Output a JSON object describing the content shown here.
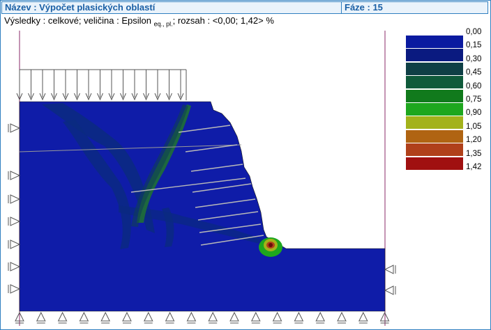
{
  "header": {
    "title": "Název : Výpočet plasických oblastí",
    "phase": "Fáze : 15"
  },
  "results": {
    "prefix": "Výsledky : celkové; veličina : Epsilon",
    "subscript": "eq., pl.",
    "suffix": "; rozsah : <0,00; 1,42> %"
  },
  "legend": {
    "labels": [
      "0,00",
      "0,15",
      "0,30",
      "0,45",
      "0,60",
      "0,75",
      "0,90",
      "1,05",
      "1,20",
      "1,35",
      "1,42"
    ],
    "colors": [
      "#0a1aa0",
      "#0a1a80",
      "#0f3f45",
      "#0f5a3a",
      "#117a1c",
      "#1ea71e",
      "#a3b21a",
      "#b06412",
      "#b0401a",
      "#a01010",
      "#6a0a0a"
    ]
  },
  "colors": {
    "accent": "#2f7fc0",
    "soil": "#0f1ca8",
    "band_dark": "#0a2a80",
    "band_green": "#1f6b3a",
    "anchor": "#b8b8b8"
  },
  "icons": {
    "load": "down-arrow-icon",
    "support_horizontal": "horizontal-support-icon",
    "support_vertical": "vertical-support-icon"
  }
}
